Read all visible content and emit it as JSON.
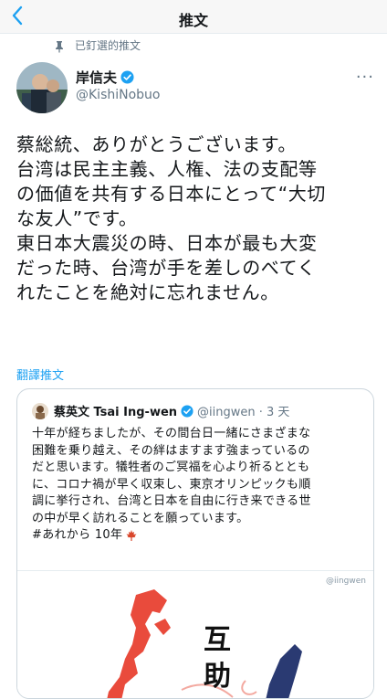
{
  "header": {
    "title": "推文",
    "back_icon": "chevron-left-icon"
  },
  "pinned": {
    "label": "已釘選的推文"
  },
  "tweet": {
    "name": "岸信夫",
    "handle": "@KishiNobuo",
    "more_icon": "···",
    "lines": [
      "蔡総統、ありがとうございます。",
      "台湾は民主主義、人権、法の支配等",
      "の価値を共有する日本にとって“大切",
      "な友人”です。",
      "東日本大震災の時、日本が最も大変",
      "だった時、台湾が手を差しのべてく",
      "れたことを絶対に忘れません。"
    ],
    "translate_label": "翻譯推文"
  },
  "quote": {
    "name": "蔡英文 Tsai Ing-wen",
    "handle_time": "@iingwen · 3 天",
    "lines": [
      "十年が経ちましたが、その間台日一緒にさまざまな",
      "困難を乗り越え、その絆はますます強まっているの",
      "だと思います。犠牲者のご冥福を心より祈るととも",
      "に、コロナ禍が早く収束し、東京オリンピックも順",
      "調に挙行され、台湾と日本を自由に行き来できる世",
      "の中が早く訪れることを願っています。"
    ],
    "hashtag_line": "#あれから 10年",
    "image": {
      "watermark": "@iingwen",
      "chars": [
        "互",
        "助"
      ]
    }
  },
  "colors": {
    "accent": "#1da1f2",
    "japan": "#e94b3c",
    "taiwan": "#2a3a72"
  }
}
